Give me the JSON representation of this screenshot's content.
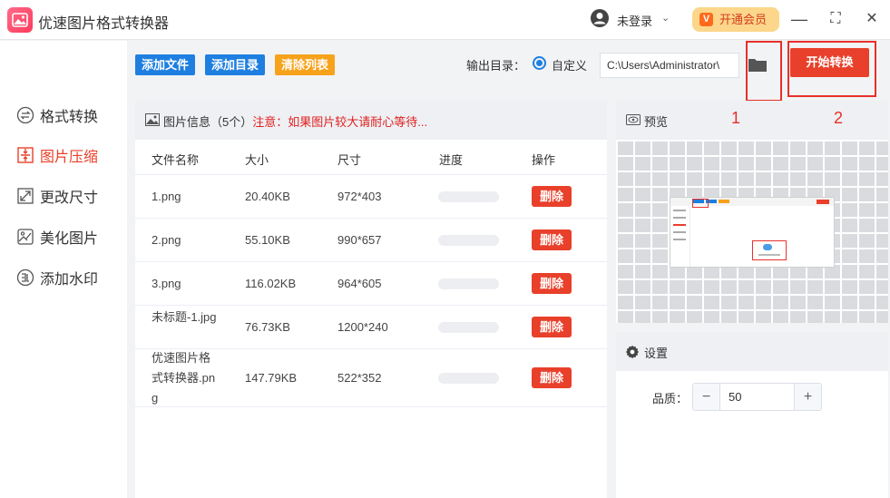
{
  "app": {
    "title": "优速图片格式转换器"
  },
  "user": {
    "label": "未登录",
    "caret": "⌄"
  },
  "vip": {
    "label": "开通会员",
    "icon_char": "V"
  },
  "window": {
    "minimize": "—",
    "maximize": "⛶",
    "close": "✕"
  },
  "sidebar": {
    "items": [
      {
        "label": "格式转换",
        "icon": "format-convert-icon"
      },
      {
        "label": "图片压缩",
        "icon": "compress-icon",
        "active": true
      },
      {
        "label": "更改尺寸",
        "icon": "resize-icon"
      },
      {
        "label": "美化图片",
        "icon": "beautify-icon"
      },
      {
        "label": "添加水印",
        "icon": "watermark-icon"
      }
    ]
  },
  "toolbar": {
    "add_file": "添加文件",
    "add_folder": "添加目录",
    "clear_list": "清除列表",
    "output_label": "输出目录：",
    "custom_label": "自定义",
    "output_path": "C:\\Users\\Administrator\\",
    "start": "开始转换"
  },
  "colors": {
    "blue_btn": "#1e7fe0",
    "orange_btn": "#f7a21b",
    "accent": "#e8402a"
  },
  "file_panel": {
    "header_prefix": "图片信息（5个）",
    "header_note": "注意：如果图片较大请耐心等待...",
    "columns": [
      "文件名称",
      "大小",
      "尺寸",
      "进度",
      "操作"
    ],
    "rows": [
      {
        "name": "1.png",
        "size": "20.40KB",
        "dim": "972*403",
        "progress": 0,
        "action": "删除"
      },
      {
        "name": "2.png",
        "size": "55.10KB",
        "dim": "990*657",
        "progress": 0,
        "action": "删除"
      },
      {
        "name": "3.png",
        "size": "116.02KB",
        "dim": "964*605",
        "progress": 0,
        "action": "删除"
      },
      {
        "name": "未标题-1.jpg",
        "size": "76.73KB",
        "dim": "1200*240",
        "progress": 0,
        "action": "删除"
      },
      {
        "name": "优速图片格式转换器.png",
        "size": "147.79KB",
        "dim": "522*352",
        "progress": 0,
        "action": "删除"
      }
    ]
  },
  "preview": {
    "label": "预览"
  },
  "annotations": {
    "step1": "1",
    "step2": "2"
  },
  "settings": {
    "label": "设置",
    "quality_label": "品质：",
    "quality_value": "50",
    "minus": "−",
    "plus": "+"
  }
}
